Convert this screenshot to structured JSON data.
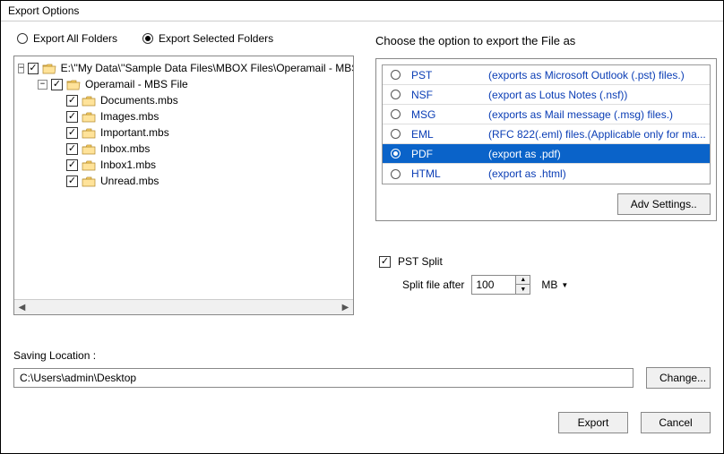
{
  "title": "Export Options",
  "radios": {
    "all": "Export All Folders",
    "selected": "Export Selected Folders"
  },
  "tree": {
    "root": "E:\\''My Data\\''Sample Data Files\\MBOX Files\\Operamail - MBS",
    "sub": "Operamail - MBS File",
    "items": [
      "Documents.mbs",
      "Images.mbs",
      "Important.mbs",
      "Inbox.mbs",
      "Inbox1.mbs",
      "Unread.mbs"
    ]
  },
  "right": {
    "header": "Choose the option to export the File as",
    "formats": [
      {
        "name": "PST",
        "desc": "(exports as Microsoft Outlook (.pst) files.)",
        "sel": false
      },
      {
        "name": "NSF",
        "desc": "(export as Lotus Notes (.nsf))",
        "sel": false
      },
      {
        "name": "MSG",
        "desc": "(exports as Mail message (.msg) files.)",
        "sel": false
      },
      {
        "name": "EML",
        "desc": "(RFC 822(.eml) files.(Applicable only for ma...",
        "sel": false
      },
      {
        "name": "PDF",
        "desc": "(export as .pdf)",
        "sel": true
      },
      {
        "name": "HTML",
        "desc": "(export as .html)",
        "sel": false
      }
    ],
    "adv": "Adv Settings..",
    "split_label": "PST Split",
    "split_after": "Split file after",
    "split_value": "100",
    "split_unit": "MB"
  },
  "saving": {
    "label": "Saving Location :",
    "path": "C:\\Users\\admin\\Desktop",
    "change": "Change..."
  },
  "buttons": {
    "export": "Export",
    "cancel": "Cancel"
  }
}
